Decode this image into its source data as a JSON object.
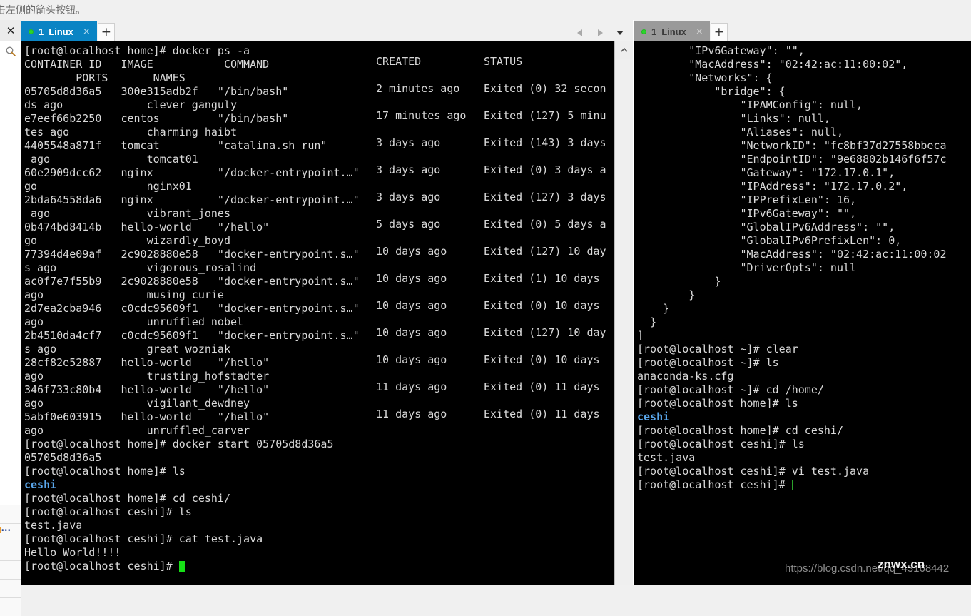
{
  "hint": {
    "text": "击左侧的箭头按钮。"
  },
  "rail": {
    "close_label": "✕",
    "search_icon": "search-icon",
    "rows": [
      {
        "kind": "plain"
      },
      {
        "kind": "dots"
      },
      {
        "kind": "plain"
      },
      {
        "kind": "plain"
      },
      {
        "kind": "plain"
      },
      {
        "kind": "plain"
      }
    ]
  },
  "left_pane": {
    "tab": {
      "dot_color": "#2bd62b",
      "number": "1",
      "label": "Linux",
      "close_label": "×",
      "state": "active"
    },
    "new_tab_label": "+",
    "nav": {
      "prev_icon": "triangle-left-icon",
      "next_icon": "triangle-right-icon",
      "menu_icon": "chevron-down-icon"
    },
    "scrollbar": {
      "up_icon": "chevron-up-icon"
    },
    "terminal_lines": [
      [
        {
          "t": "[root@localhost home]# docker ps -a",
          "c": "w"
        }
      ],
      [
        {
          "t": "CONTAINER ID   IMAGE           COMMAND",
          "c": "w"
        }
      ],
      [
        {
          "t": "        PORTS       NAMES",
          "c": "w"
        }
      ],
      [
        {
          "t": "05705d8d36a5   300e315adb2f   \"/bin/bash\"",
          "c": "w"
        }
      ],
      [
        {
          "t": "ds ago             clever_ganguly",
          "c": "w"
        }
      ],
      [
        {
          "t": "e7eef66b2250   centos         \"/bin/bash\"",
          "c": "w"
        }
      ],
      [
        {
          "t": "tes ago            charming_haibt",
          "c": "w"
        }
      ],
      [
        {
          "t": "4405548a871f   tomcat         \"catalina.sh run\"",
          "c": "w"
        }
      ],
      [
        {
          "t": " ago               tomcat01",
          "c": "w"
        }
      ],
      [
        {
          "t": "60e2909dcc62   nginx          \"/docker-entrypoint.…\"",
          "c": "w"
        }
      ],
      [
        {
          "t": "go                 nginx01",
          "c": "w"
        }
      ],
      [
        {
          "t": "2bda64558da6   nginx          \"/docker-entrypoint.…\"",
          "c": "w"
        }
      ],
      [
        {
          "t": " ago               vibrant_jones",
          "c": "w"
        }
      ],
      [
        {
          "t": "0b474bd8414b   hello-world    \"/hello\"",
          "c": "w"
        }
      ],
      [
        {
          "t": "go                 wizardly_boyd",
          "c": "w"
        }
      ],
      [
        {
          "t": "77394d4e09af   2c9028880e58   \"docker-entrypoint.s…\"",
          "c": "w"
        }
      ],
      [
        {
          "t": "s ago              vigorous_rosalind",
          "c": "w"
        }
      ],
      [
        {
          "t": "ac0f7e7f55b9   2c9028880e58   \"docker-entrypoint.s…\"",
          "c": "w"
        }
      ],
      [
        {
          "t": "ago                musing_curie",
          "c": "w"
        }
      ],
      [
        {
          "t": "2d7ea2cba946   c0cdc95609f1   \"docker-entrypoint.s…\"",
          "c": "w"
        }
      ],
      [
        {
          "t": "ago                unruffled_nobel",
          "c": "w"
        }
      ],
      [
        {
          "t": "2b4510da4cf7   c0cdc95609f1   \"docker-entrypoint.s…\"",
          "c": "w"
        }
      ],
      [
        {
          "t": "s ago              great_wozniak",
          "c": "w"
        }
      ],
      [
        {
          "t": "28cf82e52887   hello-world    \"/hello\"",
          "c": "w"
        }
      ],
      [
        {
          "t": "ago                trusting_hofstadter",
          "c": "w"
        }
      ],
      [
        {
          "t": "346f733c80b4   hello-world    \"/hello\"",
          "c": "w"
        }
      ],
      [
        {
          "t": "ago                vigilant_dewdney",
          "c": "w"
        }
      ],
      [
        {
          "t": "5abf0e603915   hello-world    \"/hello\"",
          "c": "w"
        }
      ],
      [
        {
          "t": "ago                unruffled_carver",
          "c": "w"
        }
      ],
      [
        {
          "t": "[root@localhost home]# docker start 05705d8d36a5",
          "c": "w"
        }
      ],
      [
        {
          "t": "05705d8d36a5",
          "c": "w"
        }
      ],
      [
        {
          "t": "[root@localhost home]# ls",
          "c": "w"
        }
      ],
      [
        {
          "t": "ceshi",
          "c": "b"
        }
      ],
      [
        {
          "t": "[root@localhost home]# cd ceshi/",
          "c": "w"
        }
      ],
      [
        {
          "t": "[root@localhost ceshi]# ls",
          "c": "w"
        }
      ],
      [
        {
          "t": "test.java",
          "c": "w"
        }
      ],
      [
        {
          "t": "[root@localhost ceshi]# cat test.java",
          "c": "w"
        }
      ],
      [
        {
          "t": "Hello World!!!!",
          "c": "w"
        }
      ],
      [
        {
          "t": "[root@localhost ceshi]# ",
          "c": "w"
        },
        {
          "t": "",
          "c": "cursor-solid"
        }
      ]
    ],
    "columns_right": [
      {
        "created": "CREATED",
        "status": "STATUS"
      },
      {
        "created": "2 minutes ago",
        "status": "Exited (0) 32 secon"
      },
      {
        "created": "17 minutes ago",
        "status": "Exited (127) 5 minu"
      },
      {
        "created": "3 days ago",
        "status": "Exited (143) 3 days"
      },
      {
        "created": "3 days ago",
        "status": "Exited (0) 3 days a"
      },
      {
        "created": "3 days ago",
        "status": "Exited (127) 3 days"
      },
      {
        "created": "5 days ago",
        "status": "Exited (0) 5 days a"
      },
      {
        "created": "10 days ago",
        "status": "Exited (127) 10 day"
      },
      {
        "created": "10 days ago",
        "status": "Exited (1) 10 days"
      },
      {
        "created": "10 days ago",
        "status": "Exited (0) 10 days"
      },
      {
        "created": "10 days ago",
        "status": "Exited (127) 10 day"
      },
      {
        "created": "10 days ago",
        "status": "Exited (0) 10 days"
      },
      {
        "created": "11 days ago",
        "status": "Exited (0) 11 days"
      },
      {
        "created": "11 days ago",
        "status": "Exited (0) 11 days"
      }
    ]
  },
  "right_pane": {
    "tab": {
      "dot_color": "#2bd62b",
      "number": "1",
      "label": "Linux",
      "close_label": "×",
      "state": "inactive"
    },
    "new_tab_label": "+",
    "terminal_lines": [
      [
        {
          "t": "        \"IPv6Gateway\": \"\",",
          "c": "w"
        }
      ],
      [
        {
          "t": "        \"MacAddress\": \"02:42:ac:11:00:02\",",
          "c": "w"
        }
      ],
      [
        {
          "t": "        \"Networks\": {",
          "c": "w"
        }
      ],
      [
        {
          "t": "            \"bridge\": {",
          "c": "w"
        }
      ],
      [
        {
          "t": "                \"IPAMConfig\": null,",
          "c": "w"
        }
      ],
      [
        {
          "t": "                \"Links\": null,",
          "c": "w"
        }
      ],
      [
        {
          "t": "                \"Aliases\": null,",
          "c": "w"
        }
      ],
      [
        {
          "t": "                \"NetworkID\": \"fc8bf37d27558bbeca",
          "c": "w"
        }
      ],
      [
        {
          "t": "                \"EndpointID\": \"9e68802b146f6f57c",
          "c": "w"
        }
      ],
      [
        {
          "t": "                \"Gateway\": \"172.17.0.1\",",
          "c": "w"
        }
      ],
      [
        {
          "t": "                \"IPAddress\": \"172.17.0.2\",",
          "c": "w"
        }
      ],
      [
        {
          "t": "                \"IPPrefixLen\": 16,",
          "c": "w"
        }
      ],
      [
        {
          "t": "                \"IPv6Gateway\": \"\",",
          "c": "w"
        }
      ],
      [
        {
          "t": "                \"GlobalIPv6Address\": \"\",",
          "c": "w"
        }
      ],
      [
        {
          "t": "                \"GlobalIPv6PrefixLen\": 0,",
          "c": "w"
        }
      ],
      [
        {
          "t": "                \"MacAddress\": \"02:42:ac:11:00:02",
          "c": "w"
        }
      ],
      [
        {
          "t": "                \"DriverOpts\": null",
          "c": "w"
        }
      ],
      [
        {
          "t": "            }",
          "c": "w"
        }
      ],
      [
        {
          "t": "        }",
          "c": "w"
        }
      ],
      [
        {
          "t": "    }",
          "c": "w"
        }
      ],
      [
        {
          "t": "  }",
          "c": "w"
        }
      ],
      [
        {
          "t": "]",
          "c": "w"
        }
      ],
      [
        {
          "t": "[root@localhost ~]# clear",
          "c": "w"
        }
      ],
      [
        {
          "t": "[root@localhost ~]# ls",
          "c": "w"
        }
      ],
      [
        {
          "t": "anaconda-ks.cfg",
          "c": "w"
        }
      ],
      [
        {
          "t": "[root@localhost ~]# cd /home/",
          "c": "w"
        }
      ],
      [
        {
          "t": "[root@localhost home]# ls",
          "c": "w"
        }
      ],
      [
        {
          "t": "ceshi",
          "c": "b"
        }
      ],
      [
        {
          "t": "[root@localhost home]# cd ceshi/",
          "c": "w"
        }
      ],
      [
        {
          "t": "[root@localhost ceshi]# ls",
          "c": "w"
        }
      ],
      [
        {
          "t": "test.java",
          "c": "w"
        }
      ],
      [
        {
          "t": "[root@localhost ceshi]# vi test.java",
          "c": "w"
        }
      ],
      [
        {
          "t": "[root@localhost ceshi]# ",
          "c": "w"
        },
        {
          "t": "",
          "c": "cursor-hollow"
        }
      ]
    ]
  },
  "watermark": {
    "url": "https://blog.csdn.net/qq_43168442",
    "site": "znwx.cn"
  }
}
